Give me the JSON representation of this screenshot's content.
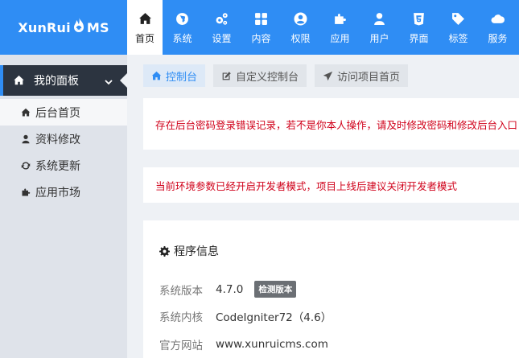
{
  "brand": {
    "logo_left": "XunRui",
    "logo_right": "MS",
    "primary_color": "#2f8df4"
  },
  "nav": [
    {
      "label": "首页",
      "icon": "home-icon",
      "active": true
    },
    {
      "label": "系统",
      "icon": "globe-icon"
    },
    {
      "label": "设置",
      "icon": "cogs-icon"
    },
    {
      "label": "内容",
      "icon": "grid-icon"
    },
    {
      "label": "权限",
      "icon": "user-circle-icon"
    },
    {
      "label": "应用",
      "icon": "puzzle-icon"
    },
    {
      "label": "用户",
      "icon": "user-icon"
    },
    {
      "label": "界面",
      "icon": "html5-icon"
    },
    {
      "label": "标签",
      "icon": "tag-icon"
    },
    {
      "label": "服务",
      "icon": "cloud-icon"
    }
  ],
  "sidebar": {
    "section_title": "我的面板",
    "items": [
      {
        "label": "后台首页",
        "icon": "home-icon",
        "active": true
      },
      {
        "label": "资料修改",
        "icon": "user-icon"
      },
      {
        "label": "系统更新",
        "icon": "refresh-icon"
      },
      {
        "label": "应用市场",
        "icon": "puzzle-icon"
      }
    ]
  },
  "tabs": [
    {
      "label": "控制台",
      "icon": "home-icon",
      "active": true
    },
    {
      "label": "自定义控制台",
      "icon": "edit-icon"
    },
    {
      "label": "访问项目首页",
      "icon": "send-icon"
    }
  ],
  "alerts": {
    "login_warning": "存在后台密码登录错误记录，若不是你本人操作，请及时修改密码和修改后台入口",
    "dev_mode_warning": "当前环境参数已经开启开发者模式，项目上线后建议关闭开发者模式"
  },
  "program_info": {
    "title": "程序信息",
    "version_label": "系统版本",
    "version_value": "4.7.0",
    "check_button": "检测版本",
    "core_label": "系统内核",
    "core_value": "CodeIgniter72（4.6）",
    "site_label": "官方网站",
    "site_value": "www.xunruicms.com"
  }
}
